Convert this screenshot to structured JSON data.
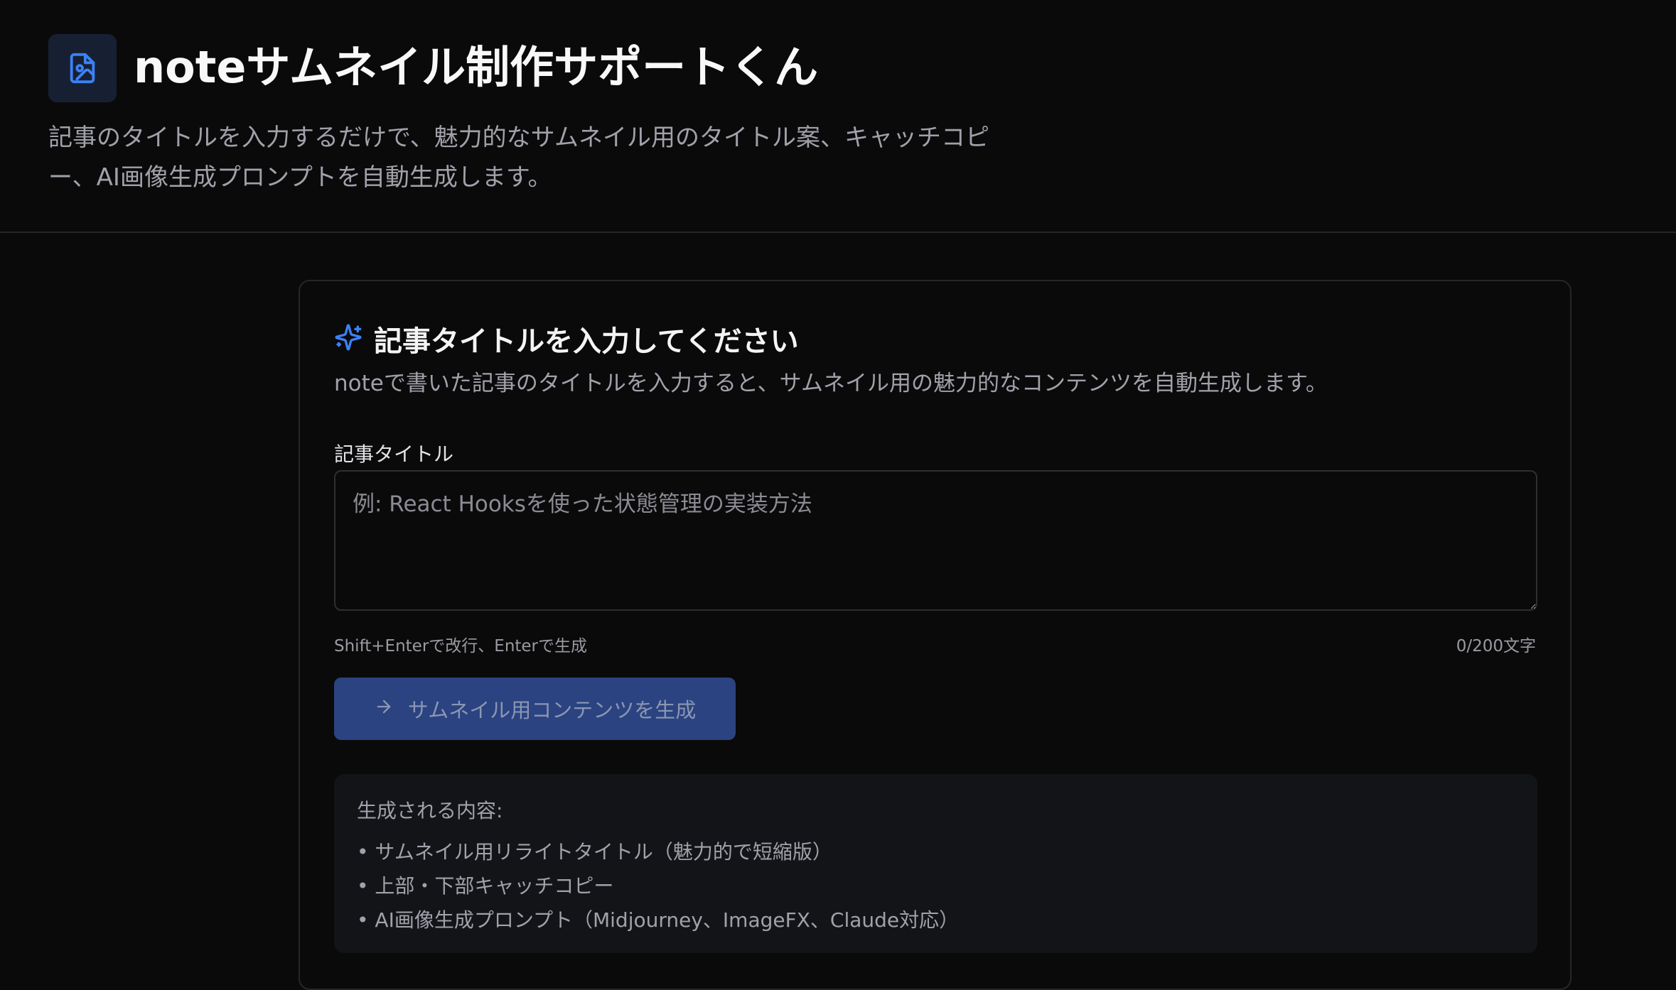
{
  "header": {
    "title": "noteサムネイル制作サポートくん",
    "description": "記事のタイトルを入力するだけで、魅力的なサムネイル用のタイトル案、キャッチコピー、AI画像生成プロンプトを自動生成します。",
    "icon": "file-image-icon"
  },
  "card": {
    "title": "記事タイトルを入力してください",
    "title_icon": "sparkles-icon",
    "description": "noteで書いた記事のタイトルを入力すると、サムネイル用の魅力的なコンテンツを自動生成します。",
    "field_label": "記事タイトル",
    "textarea": {
      "value": "",
      "placeholder": "例: React Hooksを使った状態管理の実装方法"
    },
    "hint": "Shift+Enterで改行、Enterで生成",
    "counter": "0/200文字",
    "generate_button": {
      "label": "サムネイル用コンテンツを生成",
      "icon": "arrow-right-icon",
      "disabled": true
    },
    "info": {
      "heading": "生成される内容:",
      "items": [
        "サムネイル用リライトタイトル（魅力的で短縮版）",
        "上部・下部キャッチコピー",
        "AI画像生成プロンプト（Midjourney、ImageFX、Claude対応）"
      ]
    }
  },
  "colors": {
    "background": "#0a0a0b",
    "accent": "#3b82f6",
    "button_disabled": "#2b4380",
    "muted_text": "#a1a1aa",
    "border": "#26272b"
  }
}
